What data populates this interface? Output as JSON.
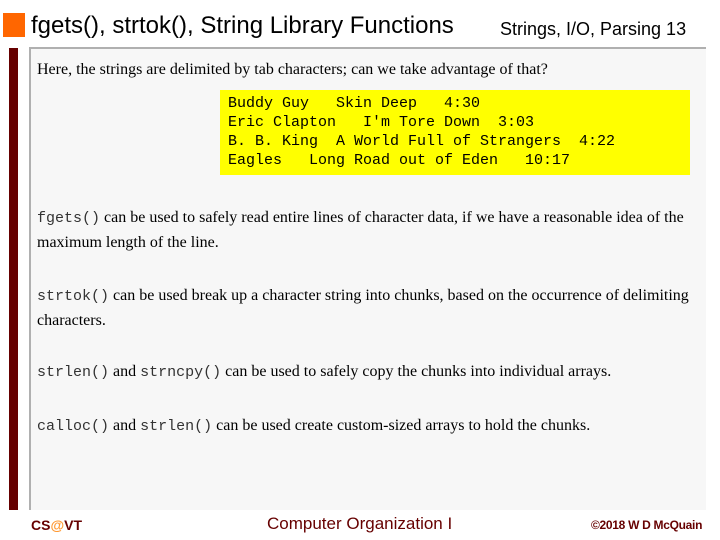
{
  "header": {
    "title": "fgets(), strtok(), String Library Functions",
    "subtitle": "Strings, I/O, Parsing 13",
    "accent_color": "#ff6600"
  },
  "content": {
    "intro": "Here, the strings are delimited by tab characters; can we take advantage of that?",
    "code_lines": [
      "Buddy Guy   Skin Deep   4:30",
      "Eric Clapton   I'm Tore Down  3:03",
      "B. B. King  A World Full of Strangers  4:22",
      "Eagles   Long Road out of Eden   10:17"
    ],
    "code_background": "#ffff00",
    "paragraphs": [
      {
        "code1": "fgets()",
        "text1": " can be used to safely read entire lines of character data, if we have a reasonable idea of the maximum length of the line."
      },
      {
        "code1": "strtok()",
        "text1": " can be used break up a character string into chunks, based on the occurrence of delimiting characters."
      },
      {
        "code1": "strlen()",
        "text1": " and ",
        "code2": "strncpy()",
        "text2": " can be used to safely copy the chunks into individual arrays."
      },
      {
        "code1": "calloc()",
        "text1": " and ",
        "code2": "strlen()",
        "text2": " can be used create custom-sized arrays to hold the chunks."
      }
    ]
  },
  "footer": {
    "left_prefix": "CS",
    "left_at": "@",
    "left_suffix": "VT",
    "center": "Computer Organization I",
    "right": "©2018 W D McQuain",
    "brand_color": "#660000"
  }
}
